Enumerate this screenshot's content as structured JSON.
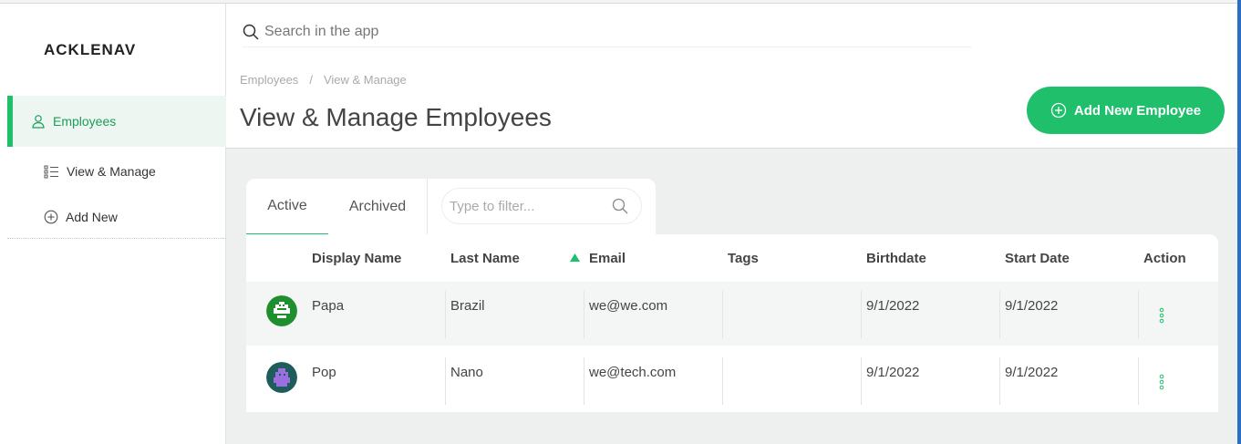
{
  "app": {
    "logo": "ACKLENAV"
  },
  "sidebar": {
    "items": [
      {
        "label": "Employees",
        "icon": "user-icon",
        "active": true
      },
      {
        "label": "View & Manage",
        "icon": "list-icon"
      },
      {
        "label": "Add New",
        "icon": "plus-circle-icon"
      }
    ]
  },
  "search": {
    "placeholder": "Search in the app"
  },
  "breadcrumb": {
    "items": [
      "Employees",
      "/",
      "View & Manage"
    ]
  },
  "page": {
    "title": "View & Manage Employees"
  },
  "actions": {
    "add_employee_label": "Add New Employee"
  },
  "tabs": {
    "active_label": "Active",
    "archived_label": "Archived"
  },
  "filter": {
    "placeholder": "Type to filter..."
  },
  "table": {
    "columns": [
      "Display Name",
      "Last Name",
      "Email",
      "Tags",
      "Birthdate",
      "Start Date",
      "Action"
    ],
    "sorted_column": "Email",
    "rows": [
      {
        "display_name": "Papa",
        "last_name": "Brazil",
        "email": "we@we.com",
        "tags": "",
        "birthdate": "9/1/2022",
        "start_date": "9/1/2022",
        "avatar": "green-pixel-avatar"
      },
      {
        "display_name": "Pop",
        "last_name": "Nano",
        "email": "we@tech.com",
        "tags": "",
        "birthdate": "9/1/2022",
        "start_date": "9/1/2022",
        "avatar": "purple-pixel-avatar"
      }
    ]
  },
  "colors": {
    "accent": "#1fbf6c",
    "active_bg": "#eef6f1",
    "page_bg": "#eef0f0"
  }
}
